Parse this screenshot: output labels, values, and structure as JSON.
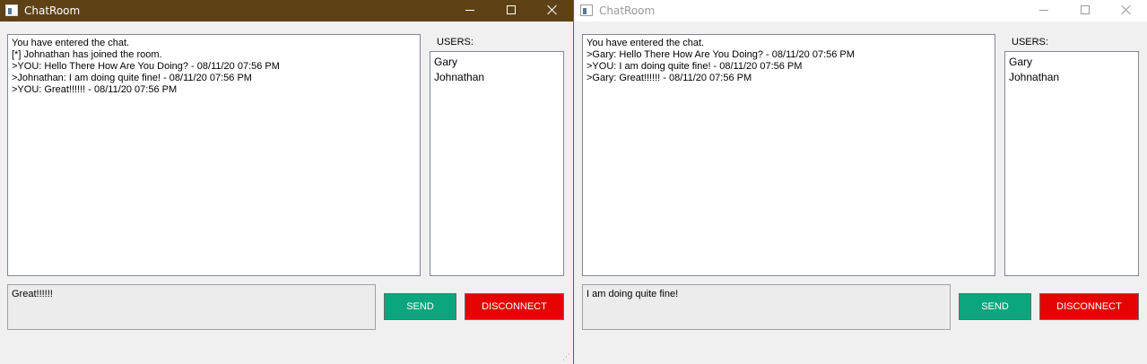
{
  "windows": [
    {
      "title": "ChatRoom",
      "active": true,
      "chat_lines": [
        "You have entered the chat.",
        "[*] Johnathan has joined the room.",
        ">YOU: Hello There How Are You Doing? -  08/11/20 07:56 PM",
        ">Johnathan: I am doing quite fine! -  08/11/20 07:56 PM",
        ">YOU: Great!!!!!! -  08/11/20 07:56 PM"
      ],
      "users_label": "USERS:",
      "users": [
        "Gary",
        "Johnathan"
      ],
      "message_input_value": "Great!!!!!!",
      "send_label": "SEND",
      "disconnect_label": "DISCONNECT"
    },
    {
      "title": "ChatRoom",
      "active": false,
      "chat_lines": [
        "You have entered the chat.",
        ">Gary: Hello There How Are You Doing? -  08/11/20 07:56 PM",
        ">YOU: I am doing quite fine! -  08/11/20 07:56 PM",
        ">Gary: Great!!!!!! -  08/11/20 07:56 PM"
      ],
      "users_label": "USERS:",
      "users": [
        "Gary",
        "Johnathan"
      ],
      "message_input_value": "I am doing quite fine!",
      "send_label": "SEND",
      "disconnect_label": "DISCONNECT"
    }
  ],
  "colors": {
    "active_titlebar": "#5e4215",
    "inactive_titlebar": "#ffffff",
    "send_button": "#0ba67e",
    "disconnect_button": "#e40202"
  },
  "icons": {
    "app": "window-icon",
    "minimize": "minimize-icon",
    "maximize": "maximize-icon",
    "close": "close-icon",
    "resize": "resize-grip-icon"
  }
}
